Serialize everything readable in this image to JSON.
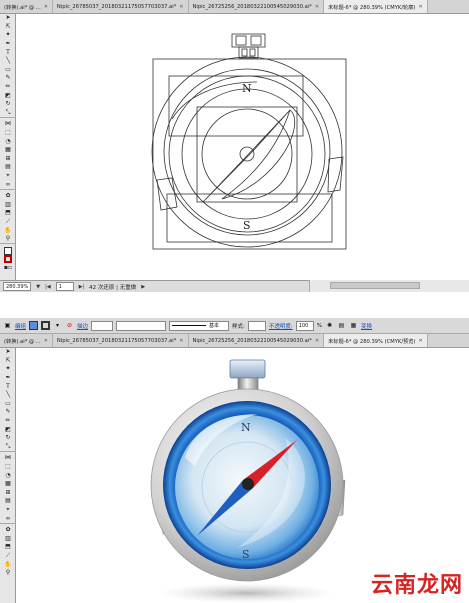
{
  "tabs_top": [
    {
      "label": "(转换).ai* @ ...",
      "active": false
    },
    {
      "label": "Nipic_26785037_20180321175057703037.ai*",
      "active": false
    },
    {
      "label": "Nipic_26725256_20180322100545029030.ai*",
      "active": false
    },
    {
      "label": "未标题-6* @ 280.39% (CMYK/轮廓)",
      "active": true
    }
  ],
  "tabs_bottom": [
    {
      "label": "(转换).ai* @ ...",
      "active": false
    },
    {
      "label": "Nipic_26785037_20180321175057703037.ai*",
      "active": false
    },
    {
      "label": "Nipic_26725256_20180322100545029030.ai*",
      "active": false
    },
    {
      "label": "未标题-6* @ 280.39% (CMYK/预览)",
      "active": true
    }
  ],
  "status": {
    "zoom": "280.39%",
    "page": "1",
    "message": "42 次还原 | 无重做"
  },
  "control_bar": {
    "mode_label": "编组",
    "stroke_label": "描边",
    "stroke_weight": "",
    "brush_label": "基本",
    "style_label": "样式:",
    "opacity_label": "不透明度:",
    "opacity_value": "100",
    "opacity_unit": "%",
    "transform_label": "变换"
  },
  "compass": {
    "north": "N",
    "south": "S"
  },
  "watermark": "云南龙网",
  "colors": {
    "needle_north": "#d8202a",
    "needle_south": "#1f5fbf",
    "dial_blue": "#2f7fd0",
    "case_silver": "#c8c8c8"
  }
}
